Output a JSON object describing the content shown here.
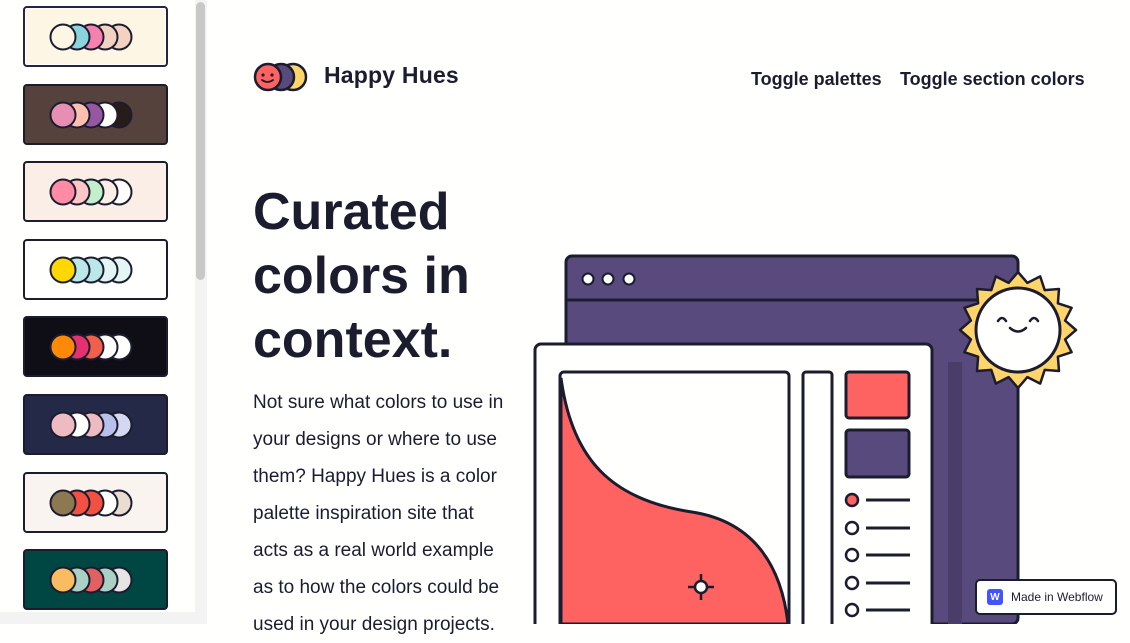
{
  "brand": {
    "name": "Happy Hues"
  },
  "nav": {
    "toggle_palettes": "Toggle palettes",
    "toggle_section_colors": "Toggle section colors"
  },
  "hero": {
    "title_lines": [
      "Curated",
      "colors in",
      "context."
    ],
    "body_lines": [
      "Not sure what colors to use in",
      "your designs or where to use",
      "them? Happy Hues is a color",
      "palette inspiration site that",
      "acts as a real world example",
      "as to how the colors could be",
      "used in your design projects."
    ]
  },
  "badge": {
    "label": "Made in Webflow",
    "logo": "W"
  },
  "palettes": [
    {
      "bg": "#fef6e4",
      "colors": [
        "#fef6e4",
        "#8bd3dd",
        "#f582ae",
        "#f3d2c1",
        "#f3d2c1"
      ]
    },
    {
      "bg": "#55423d",
      "colors": [
        "#e78fb3",
        "#ffc0ad",
        "#9656a1",
        "#fffffe",
        "#271c19"
      ]
    },
    {
      "bg": "#faeee7",
      "colors": [
        "#ff8ba7",
        "#ffc6c7",
        "#c3f0ca",
        "#faeee7",
        "#fffffe"
      ]
    },
    {
      "bg": "#fffffe",
      "colors": [
        "#ffd803",
        "#bae8e8",
        "#bae8e8",
        "#e3f6f5",
        "#e3f6f5"
      ]
    },
    {
      "bg": "#0f0e17",
      "colors": [
        "#ff8906",
        "#e53170",
        "#f25f4c",
        "#fffffe",
        "#fffffe"
      ]
    },
    {
      "bg": "#232946",
      "colors": [
        "#eebbc3",
        "#fffffe",
        "#eebbc3",
        "#b8c1ec",
        "#d4d8f0"
      ]
    },
    {
      "bg": "#f9f4ef",
      "colors": [
        "#8c7851",
        "#f25042",
        "#f25042",
        "#fffffe",
        "#eaddcf"
      ]
    },
    {
      "bg": "#004643",
      "colors": [
        "#f9bc60",
        "#abd1c6",
        "#e16162",
        "#abd1c6",
        "#e8e4e6"
      ]
    }
  ],
  "colors": {
    "ink": "#1b1d2f",
    "purple": "#594a7d",
    "coral": "#ff6361",
    "sun": "#ffd46b"
  },
  "icons": {
    "logo": "three-circles-smiley-logo",
    "sun": "smiling-sun-icon",
    "crosshair": "crosshair-icon",
    "webflow": "webflow-logo-icon"
  }
}
